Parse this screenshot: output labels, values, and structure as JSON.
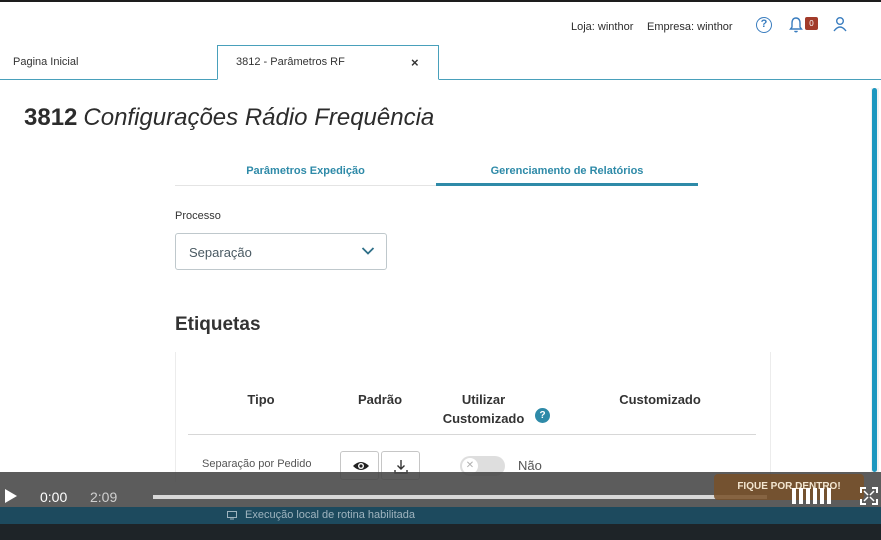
{
  "header": {
    "loja": "Loja: winthor",
    "empresa": "Empresa: winthor",
    "notification_count": "0"
  },
  "tabs": {
    "home_label": "Pagina Inicial",
    "active_label": "3812 - Parâmetros RF",
    "close_glyph": "×"
  },
  "page": {
    "code": "3812",
    "title": "Configurações Rádio Frequência",
    "subtabs": [
      "Parâmetros Expedição",
      "Gerenciamento de Relatórios"
    ],
    "active_subtab": 1
  },
  "form": {
    "process_label": "Processo",
    "process_value": "Separação"
  },
  "labels_section": {
    "title": "Etiquetas",
    "columns": {
      "tipo": "Tipo",
      "padrao": "Padrão",
      "utilizar": "Utilizar Customizado",
      "customizado": "Customizado"
    },
    "rows": [
      {
        "tipo": "Separação por Pedido",
        "utilizar_customizado": "Não"
      }
    ]
  },
  "video": {
    "current_time": "0:00",
    "duration": "2:09",
    "progress": 0,
    "promo": "FIQUE POR DENTRO!"
  },
  "status": {
    "text": "Execução local de rotina habilitada"
  },
  "colors": {
    "accent": "#2e8aa8",
    "status_bar": "#1d4a5e",
    "badge": "#a23b2a"
  }
}
